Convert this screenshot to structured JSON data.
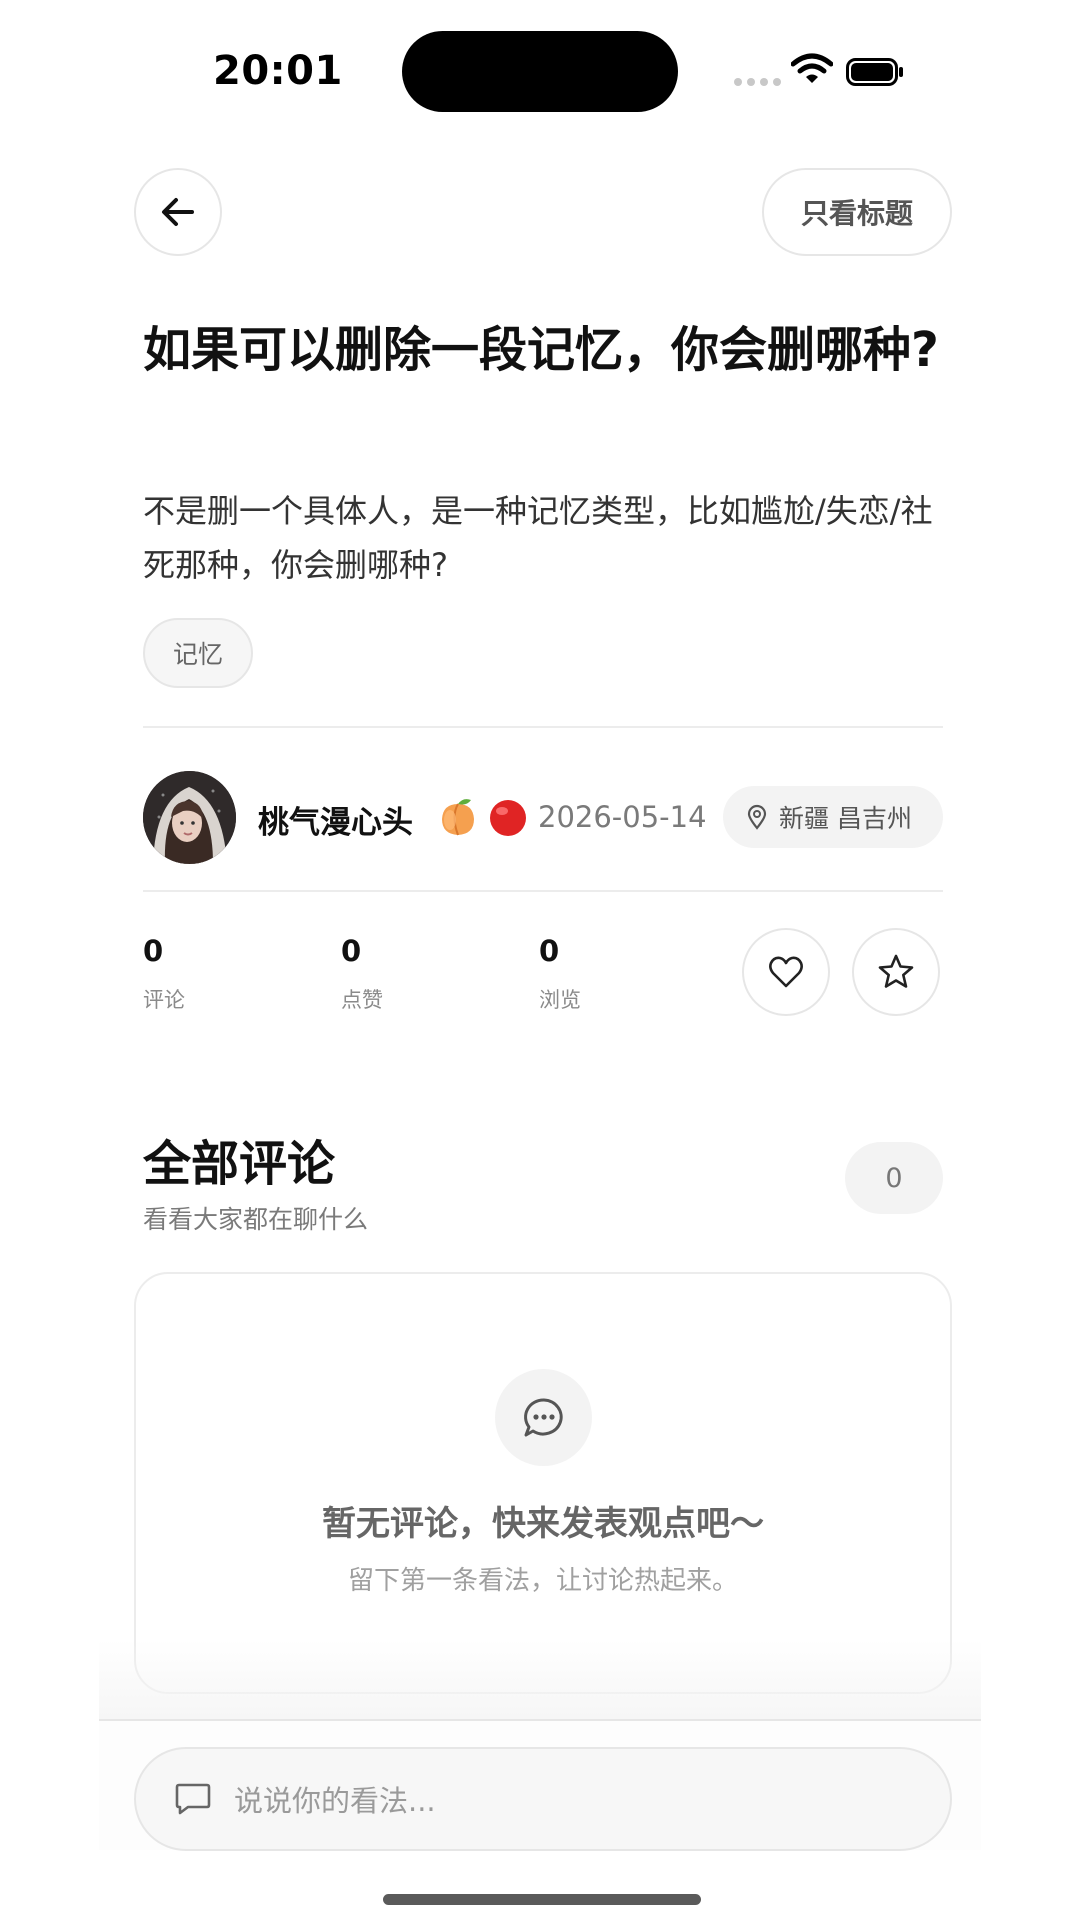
{
  "status_bar": {
    "time": "20:01"
  },
  "header": {
    "title_only_label": "只看标题"
  },
  "post": {
    "title": "如果可以删除一段记忆，你会删哪种?",
    "body": "不是删一个具体人，是一种记忆类型，比如尴尬/失恋/社死那种，你会删哪种?",
    "tag": "记忆",
    "author": {
      "name": "桃气漫心头",
      "date": "2026-05-14",
      "location": "新疆 昌吉州"
    }
  },
  "stats": {
    "comments": {
      "value": "0",
      "label": "评论"
    },
    "likes": {
      "value": "0",
      "label": "点赞"
    },
    "views": {
      "value": "0",
      "label": "浏览"
    }
  },
  "comments_section": {
    "title": "全部评论",
    "subtitle": "看看大家都在聊什么",
    "count": "0",
    "empty_title": "暂无评论，快来发表观点吧～",
    "empty_subtitle": "留下第一条看法，让讨论热起来。"
  },
  "input": {
    "placeholder": "说说你的看法..."
  },
  "icons": {
    "back": "arrow-left-icon",
    "location": "map-pin-icon",
    "like": "heart-icon",
    "favorite": "star-icon",
    "empty": "chat-bubble-icon",
    "input": "comment-icon"
  }
}
